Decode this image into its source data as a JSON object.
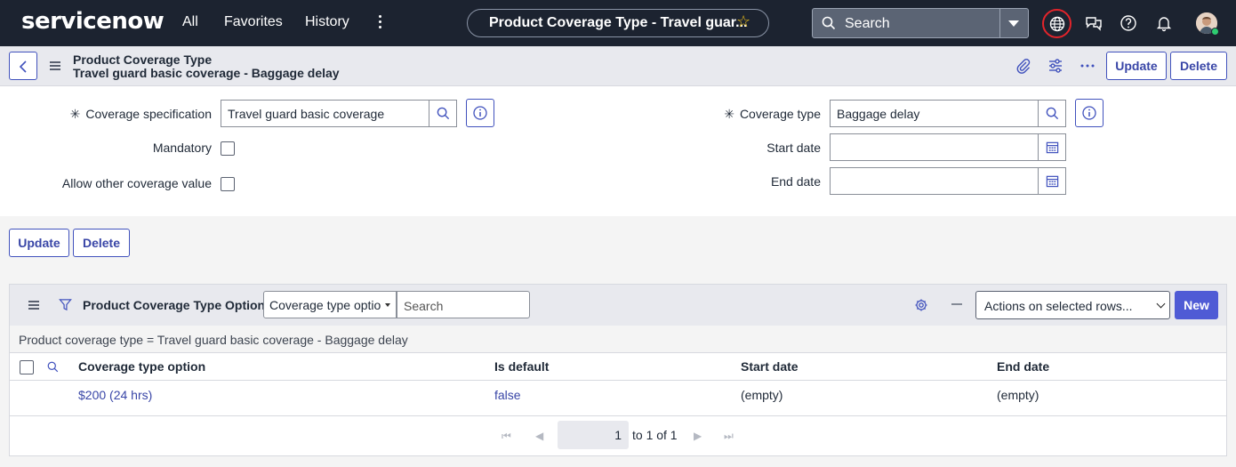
{
  "nav": {
    "logo": "servicenow",
    "links": [
      "All",
      "Favorites",
      "History"
    ],
    "record_title": "Product Coverage Type - Travel guar...",
    "search_placeholder": "Search"
  },
  "header": {
    "table_label": "Product Coverage Type",
    "record_label": "Travel guard basic coverage - Baggage delay",
    "update_label": "Update",
    "delete_label": "Delete"
  },
  "form": {
    "coverage_spec_label": "Coverage specification",
    "coverage_spec_value": "Travel guard basic coverage",
    "mandatory_label": "Mandatory",
    "allow_other_label": "Allow other coverage value",
    "coverage_type_label": "Coverage type",
    "coverage_type_value": "Baggage delay",
    "start_date_label": "Start date",
    "start_date_value": "",
    "end_date_label": "End date",
    "end_date_value": "",
    "mandatory_checked": false,
    "allow_other_checked": false
  },
  "bottom_buttons": {
    "update_label": "Update",
    "delete_label": "Delete"
  },
  "related_list": {
    "title": "Product Coverage Type Options",
    "field_select": "Coverage type optio",
    "search_placeholder": "Search",
    "actions_select": "Actions on selected rows...",
    "new_label": "New",
    "breadcrumb": "Product coverage type = Travel guard basic coverage - Baggage delay",
    "columns": [
      "Coverage type option",
      "Is default",
      "Start date",
      "End date"
    ],
    "rows": [
      {
        "option": "$200 (24 hrs)",
        "is_default": "false",
        "start_date": "(empty)",
        "end_date": "(empty)"
      }
    ],
    "pager": {
      "page": "1",
      "range_text": "to 1 of 1"
    }
  },
  "colors": {
    "accent": "#4f5bd5",
    "nav_bg": "#1c2330",
    "link": "#3946a7"
  }
}
